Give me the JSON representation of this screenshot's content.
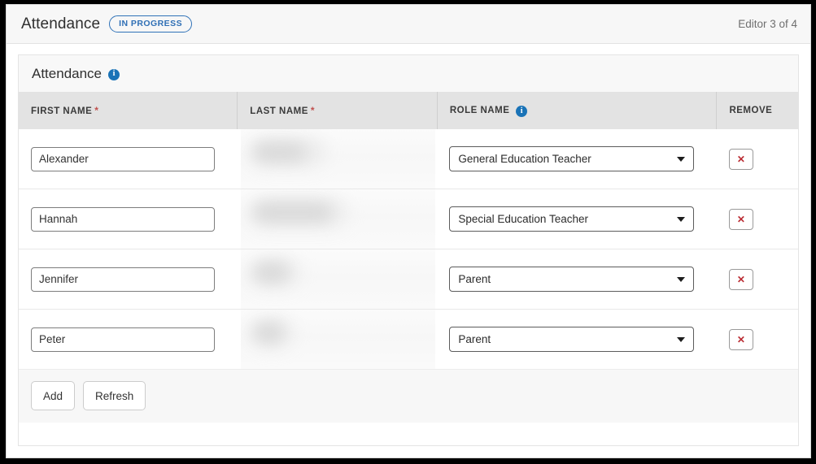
{
  "editor": {
    "title": "Attendance",
    "status_badge": "IN PROGRESS",
    "counter": "Editor 3 of 4"
  },
  "section": {
    "title": "Attendance",
    "info_icon": "info-icon",
    "info_icon_glyph": "i"
  },
  "table": {
    "columns": [
      {
        "label": "FIRST NAME",
        "required": true,
        "info": false,
        "star": "*"
      },
      {
        "label": "LAST NAME",
        "required": true,
        "info": false,
        "star": "*"
      },
      {
        "label": "ROLE NAME",
        "required": false,
        "info": true,
        "star": ""
      },
      {
        "label": "REMOVE",
        "required": false,
        "info": false,
        "star": ""
      }
    ],
    "rows": [
      {
        "first_name": "Alexander",
        "last_name": "",
        "last_name_redacted": true,
        "role": "General Education Teacher",
        "remove_label": "✕"
      },
      {
        "first_name": "Hannah",
        "last_name": "",
        "last_name_redacted": true,
        "role": "Special Education Teacher",
        "remove_label": "✕"
      },
      {
        "first_name": "Jennifer",
        "last_name": "",
        "last_name_redacted": true,
        "role": "Parent",
        "remove_label": "✕"
      },
      {
        "first_name": "Peter",
        "last_name": "",
        "last_name_redacted": true,
        "role": "Parent",
        "remove_label": "✕"
      }
    ],
    "first_name_placeholder": "",
    "last_name_placeholder": ""
  },
  "footer": {
    "add_label": "Add",
    "refresh_label": "Refresh"
  },
  "colors": {
    "accent_blue": "#1a73b7",
    "badge_blue": "#2f6fb5",
    "required_red": "#c0504d",
    "remove_red": "#bb2d34",
    "header_gray": "#e3e3e3",
    "page_gray": "#f4f4f4"
  }
}
